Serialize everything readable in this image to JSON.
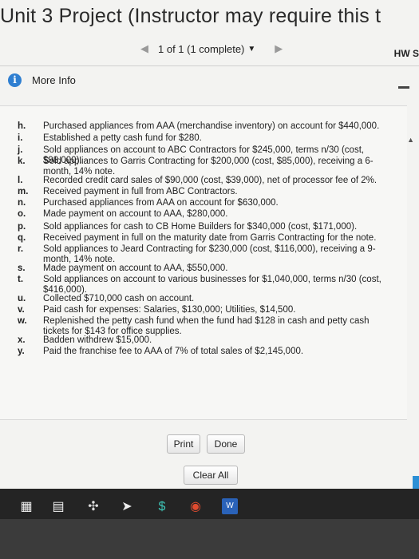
{
  "window": {
    "title": "Unit 3 Project (Instructor may require this t",
    "pager": {
      "prev_icon": "◀",
      "next_icon": "▶",
      "status": "1 of 1 (1 complete)",
      "dropdown_icon": "▼"
    },
    "hw_label": "HW S"
  },
  "info_bar": {
    "label": "More Info"
  },
  "items": [
    {
      "key": "h.",
      "text": "Purchased appliances from AAA (merchandise inventory) on account for $440,000."
    },
    {
      "key": "i.",
      "text": "Established a petty cash fund for $280."
    },
    {
      "key": "j.",
      "text": "Sold appliances on account to ABC Contractors for $245,000, terms n/30 (cost, $98,000)."
    },
    {
      "key": "k.",
      "text": "Sold appliances to Garris Contracting for $200,000 (cost, $85,000), receiving a 6-month, 14% note."
    },
    {
      "key": "l.",
      "text": "Recorded credit card sales of $90,000 (cost, $39,000), net of processor fee of 2%."
    },
    {
      "key": "m.",
      "text": "Received payment in full from ABC Contractors."
    },
    {
      "key": "n.",
      "text": "Purchased appliances from AAA on account for $630,000."
    },
    {
      "key": "o.",
      "text": "Made payment on account to AAA, $280,000."
    },
    {
      "key": "p.",
      "text": "Sold appliances for cash to CB Home Builders for $340,000 (cost, $171,000)."
    },
    {
      "key": "q.",
      "text": "Received payment in full on the maturity date from Garris Contracting for the note."
    },
    {
      "key": "r.",
      "text": "Sold appliances to Jeard Contracting for $230,000 (cost, $116,000), receiving a 9-month, 14% note."
    },
    {
      "key": "s.",
      "text": "Made payment on account to AAA, $550,000."
    },
    {
      "key": "t.",
      "text": "Sold appliances on account to various businesses for $1,040,000, terms n/30 (cost, $416,000)."
    },
    {
      "key": "u.",
      "text": "Collected $710,000 cash on account."
    },
    {
      "key": "v.",
      "text": "Paid cash for expenses: Salaries, $130,000; Utilities, $14,500."
    },
    {
      "key": "w.",
      "text": "Replenished the petty cash fund when the fund had $128 in cash and petty cash tickets for $143 for office supplies."
    },
    {
      "key": "x.",
      "text": "Badden withdrew $15,000."
    },
    {
      "key": "y.",
      "text": "Paid the franchise fee to AAA of 7% of total sales of $2,145,000."
    }
  ],
  "buttons": {
    "print": "Print",
    "done": "Done",
    "clear_all": "Clear All"
  },
  "dock": {
    "icons": [
      "sheets-icon",
      "calendar-icon",
      "dropbox-icon",
      "send-icon",
      "dollar-icon",
      "chrome-icon",
      "word-icon"
    ],
    "word_label": "W"
  }
}
